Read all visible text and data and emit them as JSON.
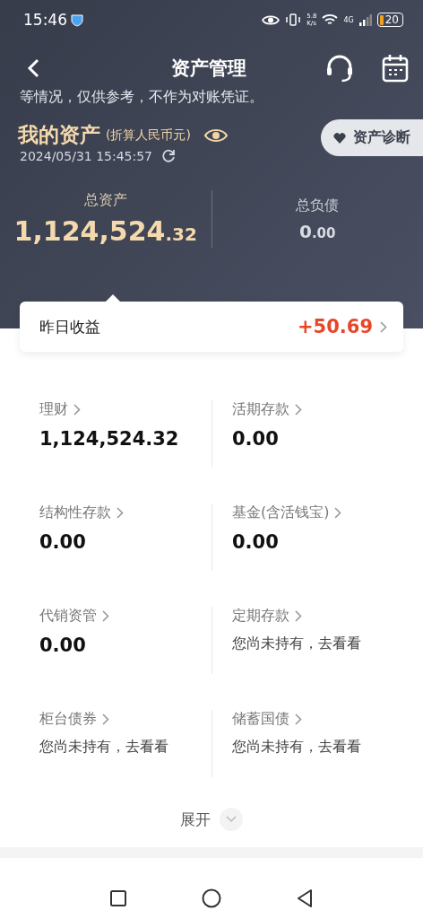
{
  "status_bar": {
    "time": "15:46",
    "speed_value": "5.8",
    "speed_unit": "K/s",
    "network": "4G",
    "battery": "20"
  },
  "header": {
    "title": "资产管理"
  },
  "notice": "等情况，仅供参考，不作为对账凭证。",
  "my_assets": {
    "title": "我的资产",
    "note": "(折算人民币元)",
    "timestamp": "2024/05/31 15:45:57",
    "diagnosis_button": "资产诊断"
  },
  "totals": [
    {
      "label": "总资产",
      "integer": "1,124,524",
      "decimal": ".32",
      "selected": true
    },
    {
      "label": "总负债",
      "integer": "0",
      "decimal": ".00",
      "selected": false
    }
  ],
  "yesterday": {
    "label": "昨日收益",
    "value": "+50.69"
  },
  "holdings": [
    {
      "label": "理财",
      "kind": "amount",
      "value": "1,124,524.32"
    },
    {
      "label": "活期存款",
      "kind": "amount",
      "value": "0.00"
    },
    {
      "label": "结构性存款",
      "kind": "amount",
      "value": "0.00"
    },
    {
      "label": "基金(含活钱宝)",
      "kind": "amount",
      "value": "0.00"
    },
    {
      "label": "代销资管",
      "kind": "amount",
      "value": "0.00"
    },
    {
      "label": "定期存款",
      "kind": "prompt",
      "value": "您尚未持有，去看看"
    },
    {
      "label": "柜台债券",
      "kind": "prompt",
      "value": "您尚未持有，去看看"
    },
    {
      "label": "储蓄国债",
      "kind": "prompt",
      "value": "您尚未持有，去看看"
    }
  ],
  "expand_button": "展开"
}
